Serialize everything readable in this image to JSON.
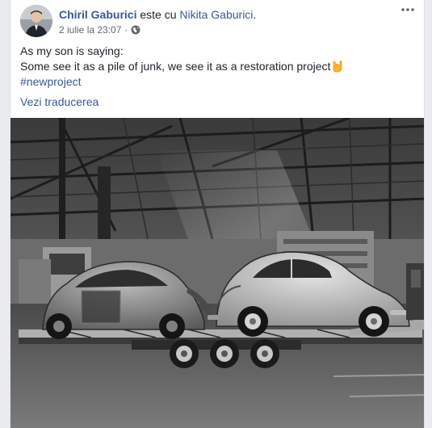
{
  "post": {
    "author": "Chiril Gaburici",
    "with_text": "este cu",
    "tagged": "Nikita Gaburici",
    "punct": ".",
    "timestamp": "2 iulie la 23:07",
    "privacy_separator": "·",
    "privacy_icon": "globe-icon",
    "more_icon": "more-options-icon",
    "text_lines": [
      "As my son is saying:",
      "Some see it as a pile of junk, we see it as a restoration project"
    ],
    "text_emoji": "rock-on-hand-emoji",
    "hashtag": "#newproject",
    "see_translation": "Vezi traducerea",
    "photo_description_icon": "photo-image"
  },
  "colors": {
    "link": "#385898",
    "text": "#1d2129",
    "muted": "#616770",
    "background": "#e9ebee",
    "card": "#ffffff"
  }
}
